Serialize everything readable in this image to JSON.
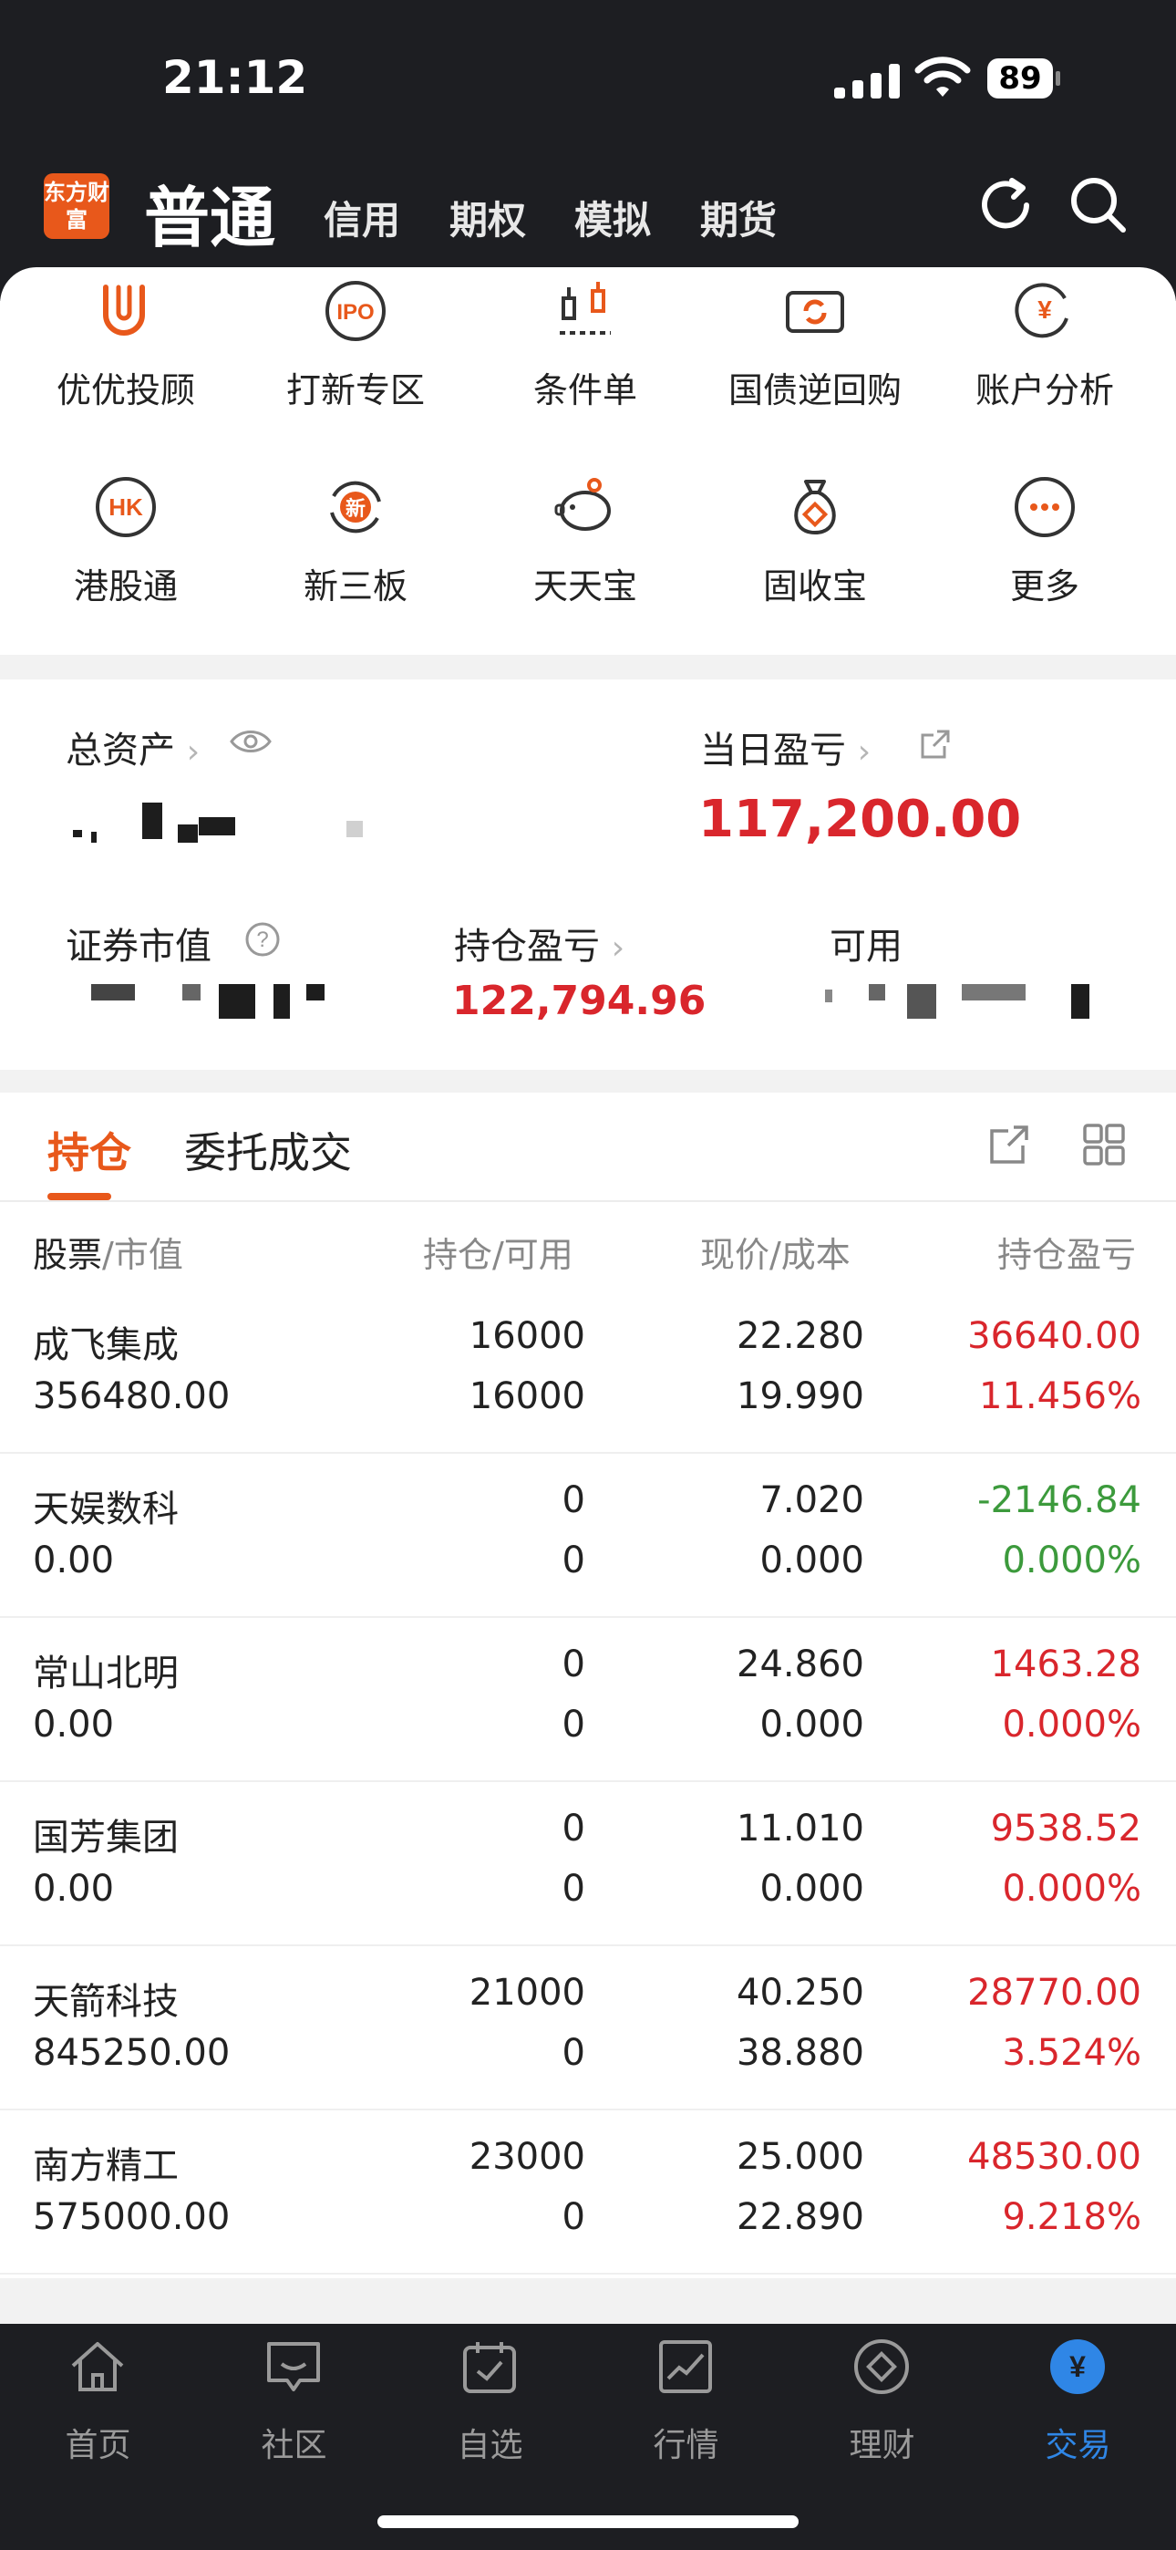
{
  "status": {
    "time": "21:12",
    "battery": "89"
  },
  "header": {
    "logo_text": "东方财富",
    "active": "普通",
    "tabs": [
      "信用",
      "期权",
      "模拟",
      "期货"
    ]
  },
  "quick": [
    {
      "label": "优优投顾",
      "icon": "uu-advisor-icon"
    },
    {
      "label": "打新专区",
      "icon": "ipo-icon",
      "glyph": "IPO"
    },
    {
      "label": "条件单",
      "icon": "conditional-order-icon"
    },
    {
      "label": "国债逆回购",
      "icon": "bond-repo-icon"
    },
    {
      "label": "账户分析",
      "icon": "account-analysis-icon",
      "glyph": "¥"
    },
    {
      "label": "港股通",
      "icon": "hk-connect-icon",
      "glyph": "HK"
    },
    {
      "label": "新三板",
      "icon": "neeq-icon",
      "glyph": "新"
    },
    {
      "label": "天天宝",
      "icon": "piggy-bank-icon"
    },
    {
      "label": "固收宝",
      "icon": "money-bag-icon"
    },
    {
      "label": "更多",
      "icon": "more-icon",
      "glyph": "···"
    }
  ],
  "assets": {
    "total_label": "总资产",
    "daily_pl_label": "当日盈亏",
    "daily_pl_value": "117,200.00",
    "market_value_label": "证券市值",
    "position_pl_label": "持仓盈亏",
    "position_pl_value": "122,794.96",
    "available_label": "可用"
  },
  "holdings": {
    "tab_active": "持仓",
    "tab_other": "委托成交",
    "columns": {
      "stock": "股票",
      "market_value": "/市值",
      "position": "持仓/可用",
      "price": "现价/成本",
      "pl": "持仓盈亏"
    },
    "rows": [
      {
        "name": "成飞集成",
        "value": "356480.00",
        "qty": "16000",
        "avail": "16000",
        "price": "22.280",
        "cost": "19.990",
        "pl": "36640.00",
        "pct": "11.456%",
        "tone": "red"
      },
      {
        "name": "天娱数科",
        "value": "0.00",
        "qty": "0",
        "avail": "0",
        "price": "7.020",
        "cost": "0.000",
        "pl": "-2146.84",
        "pct": "0.000%",
        "tone": "green"
      },
      {
        "name": "常山北明",
        "value": "0.00",
        "qty": "0",
        "avail": "0",
        "price": "24.860",
        "cost": "0.000",
        "pl": "1463.28",
        "pct": "0.000%",
        "tone": "red"
      },
      {
        "name": "国芳集团",
        "value": "0.00",
        "qty": "0",
        "avail": "0",
        "price": "11.010",
        "cost": "0.000",
        "pl": "9538.52",
        "pct": "0.000%",
        "tone": "red"
      },
      {
        "name": "天箭科技",
        "value": "845250.00",
        "qty": "21000",
        "avail": "0",
        "price": "40.250",
        "cost": "38.880",
        "pl": "28770.00",
        "pct": "3.524%",
        "tone": "red"
      },
      {
        "name": "南方精工",
        "value": "575000.00",
        "qty": "23000",
        "avail": "0",
        "price": "25.000",
        "cost": "22.890",
        "pl": "48530.00",
        "pct": "9.218%",
        "tone": "red"
      }
    ]
  },
  "bottom_nav": [
    {
      "label": "首页",
      "icon": "home-icon"
    },
    {
      "label": "社区",
      "icon": "community-icon"
    },
    {
      "label": "自选",
      "icon": "watchlist-icon"
    },
    {
      "label": "行情",
      "icon": "market-icon"
    },
    {
      "label": "理财",
      "icon": "wealth-icon"
    },
    {
      "label": "交易",
      "icon": "trade-icon",
      "active": true
    }
  ],
  "colors": {
    "accent": "#e8581b",
    "up": "#d9262c",
    "down": "#3c9a3c",
    "active_nav": "#2f86e6"
  }
}
